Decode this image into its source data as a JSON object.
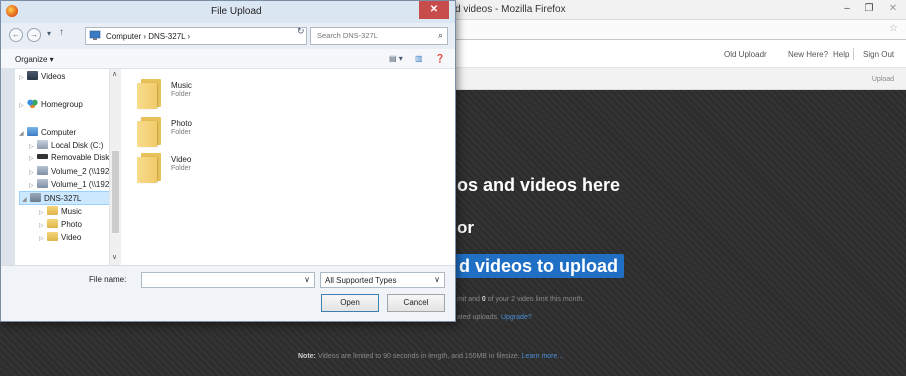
{
  "firefox": {
    "title": "d videos - Mozilla Firefox",
    "minimize": "–",
    "maximize": "❐",
    "close": "✕",
    "star": "☆"
  },
  "site": {
    "nav": {
      "old_uploader": "Old Uploadr",
      "new_here": "New Here?",
      "help": "Help",
      "sign_out": "Sign Out"
    },
    "upload_tab": "Upload",
    "drop_text": "os and videos here",
    "or_text": "or",
    "select_button": "d videos to upload",
    "limit_text_pre": "mit and ",
    "limit_count": "0",
    "limit_text_post": " of your 2 video limit this month.",
    "unlimited_pre": "ated uploads. ",
    "upgrade_link": "Upgrade?",
    "note_label": "Note:",
    "note_text": " Videos are limited to 90 seconds in length, and 150MB in filesize. ",
    "learn_more": "Learn more..."
  },
  "dialog": {
    "title": "File Upload",
    "close": "✕",
    "nav": {
      "back": "←",
      "forward": "→",
      "recent": "▾",
      "up": "↑"
    },
    "address": "Computer  ›  DNS-327L  ›",
    "address_drop": "∨",
    "refresh": "↻",
    "search_placeholder": "Search DNS-327L",
    "search_icon": "⌕",
    "organize": "Organize ▾",
    "view_icon": "▤ ▾",
    "pane_icon": "▥",
    "help_icon": "❓",
    "scroll_up": "∧",
    "scroll_down": "∨",
    "nav_items": [
      {
        "label": "Videos",
        "icon": "video-library-icon"
      },
      {
        "label": "Homegroup",
        "icon": "homegroup-icon"
      },
      {
        "label": "Computer",
        "icon": "computer-icon"
      },
      {
        "label": "Local Disk (C:)",
        "icon": "local-disk-icon"
      },
      {
        "label": "Removable Disk (",
        "icon": "removable-disk-icon"
      },
      {
        "label": "Volume_2 (\\\\192.",
        "icon": "network-drive-icon"
      },
      {
        "label": "Volume_1 (\\\\192.",
        "icon": "network-drive-icon"
      },
      {
        "label": "DNS-327L",
        "icon": "nas-device-icon"
      },
      {
        "label": "Music",
        "icon": "folder-icon"
      },
      {
        "label": "Photo",
        "icon": "folder-icon"
      },
      {
        "label": "Video",
        "icon": "folder-icon"
      }
    ],
    "files": [
      {
        "name": "Music",
        "type": "Folder"
      },
      {
        "name": "Photo",
        "type": "Folder"
      },
      {
        "name": "Video",
        "type": "Folder"
      }
    ],
    "file_name_label": "File name:",
    "file_name_value": "",
    "file_name_drop": "∨",
    "file_type": "All Supported Types",
    "file_type_drop": "∨",
    "open_button": "Open",
    "cancel_button": "Cancel"
  }
}
